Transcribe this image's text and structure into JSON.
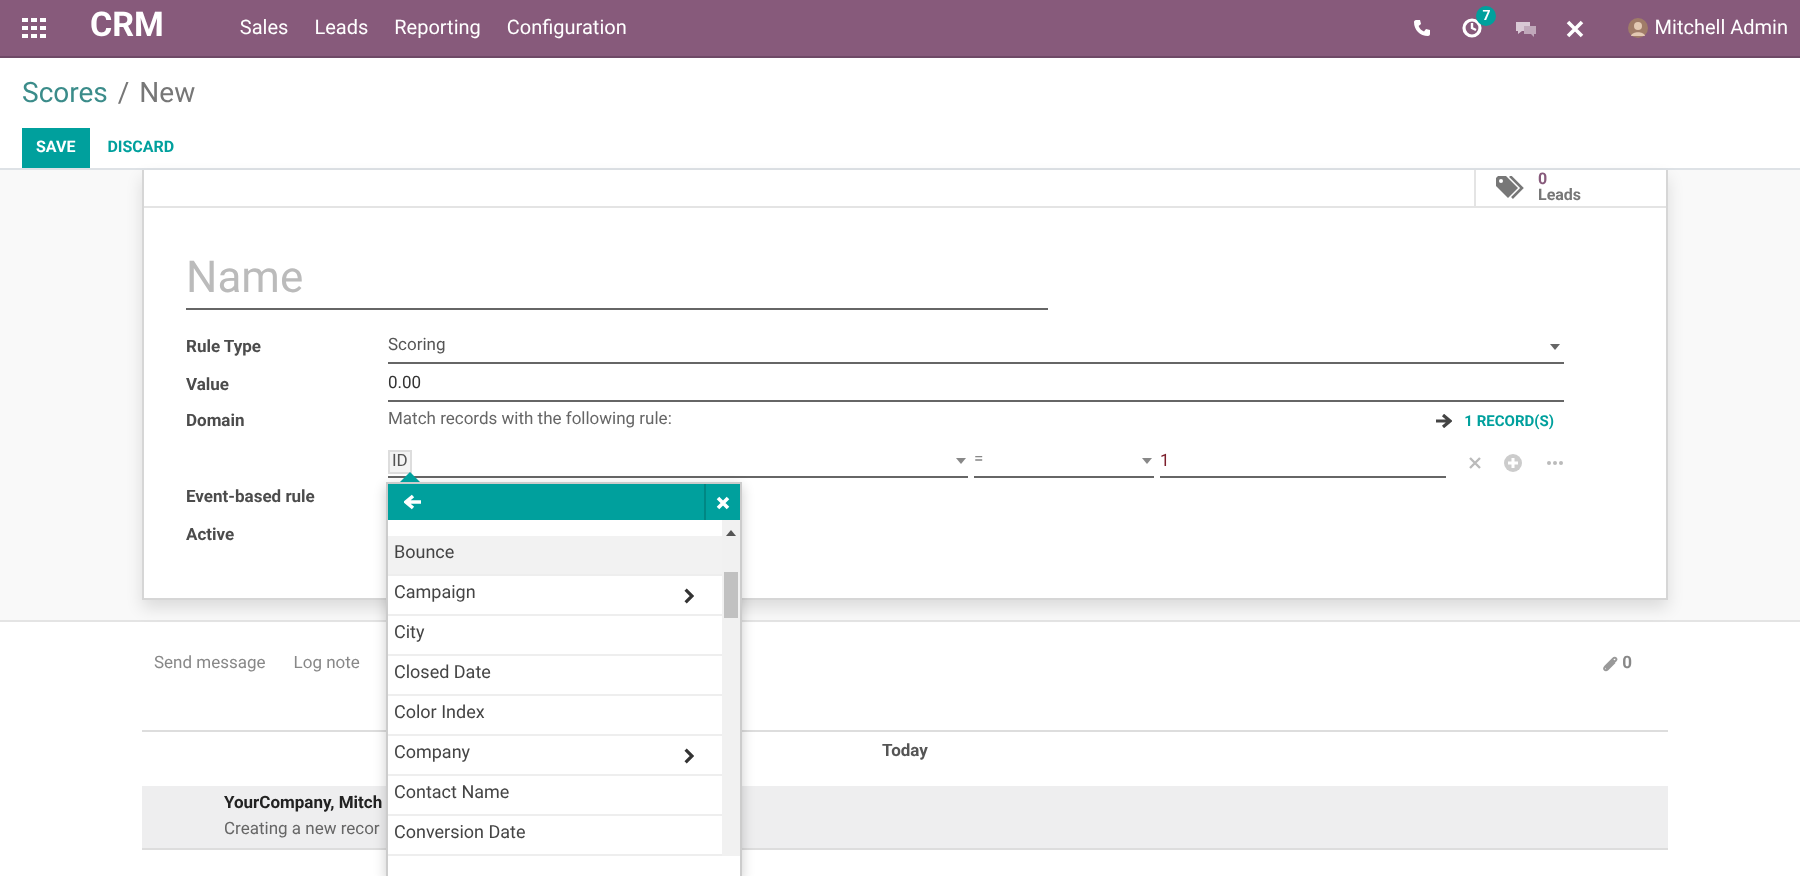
{
  "navbar": {
    "app": "CRM",
    "menu": [
      "Sales",
      "Leads",
      "Reporting",
      "Configuration"
    ],
    "activity_count": "7",
    "user": "Mitchell Admin"
  },
  "breadcrumb": {
    "parent": "Scores",
    "separator": "/",
    "current": "New"
  },
  "buttons": {
    "save": "SAVE",
    "discard": "DISCARD"
  },
  "stat_button": {
    "value": "0",
    "label": "Leads"
  },
  "form": {
    "name_placeholder": "Name",
    "fields": [
      {
        "kind": "select",
        "label": "Rule Type",
        "value": "Scoring"
      },
      {
        "kind": "input",
        "label": "Value",
        "value": "0.00"
      },
      {
        "kind": "domain",
        "label": "Domain",
        "value": "Match records with the following rule:"
      },
      {
        "kind": "checkbox",
        "label": "Event-based rule"
      },
      {
        "kind": "checkbox",
        "label": "Active"
      }
    ],
    "domain": {
      "records_link": "1 RECORD(S)",
      "field": "ID",
      "operator": "=",
      "value": "1"
    }
  },
  "field_dropdown": {
    "items": [
      {
        "label": "Bounce",
        "selected": true,
        "has_children": false
      },
      {
        "label": "Campaign",
        "selected": false,
        "has_children": true
      },
      {
        "label": "City",
        "selected": false,
        "has_children": false
      },
      {
        "label": "Closed Date",
        "selected": false,
        "has_children": false
      },
      {
        "label": "Color Index",
        "selected": false,
        "has_children": false
      },
      {
        "label": "Company",
        "selected": false,
        "has_children": true
      },
      {
        "label": "Contact Name",
        "selected": false,
        "has_children": false
      },
      {
        "label": "Conversion Date",
        "selected": false,
        "has_children": false
      }
    ]
  },
  "chatter": {
    "send_message": "Send message",
    "log_note": "Log note",
    "attachments": "0",
    "date_divider": "Today",
    "message": {
      "author": "YourCompany, Mitch",
      "body": "Creating a new recor"
    }
  }
}
